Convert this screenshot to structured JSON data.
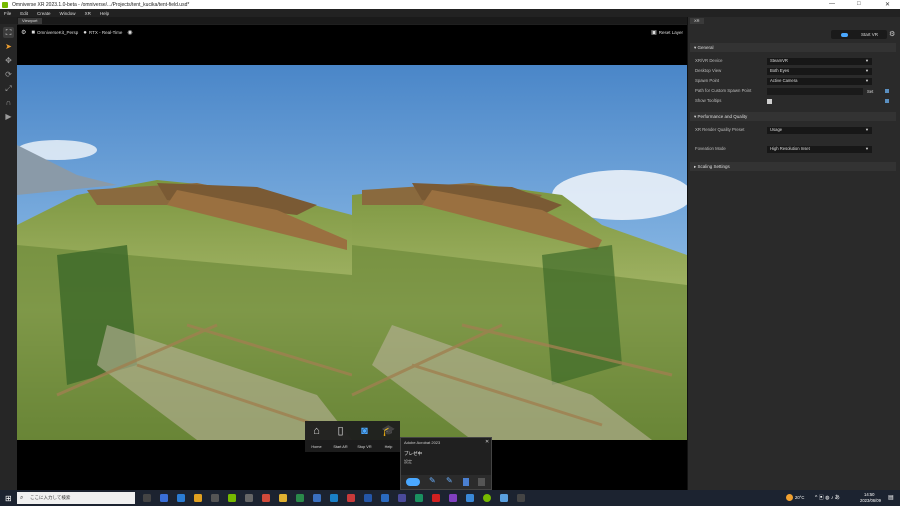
{
  "window": {
    "title": "Omniverse XR 2023.1.0-beta - /omniverse/.../Projects/tent_kucika/tent-field.usd*",
    "controls": [
      "—",
      "□",
      "✕"
    ]
  },
  "menu": [
    "File",
    "Edit",
    "Create",
    "Window",
    "XR",
    "Help"
  ],
  "viewport_tab": "Viewport",
  "viewport_toolbar": {
    "camera": "OmniverseKit_Persp",
    "renderer": "RTX - Real-Time",
    "right": "Reset Layer"
  },
  "xr_panel": {
    "tab": "XR",
    "start_button": "Start VR",
    "sections": {
      "general": "General",
      "performance": "Performance and Quality",
      "scaling": "Scaling Settings"
    },
    "rows": [
      {
        "label": "XR/VR Device",
        "value": "SteamVR"
      },
      {
        "label": "Desktop View",
        "value": "Both Eyes"
      },
      {
        "label": "Spawn Point",
        "value": "Active Camera"
      },
      {
        "label": "Path for Custom Spawn Point",
        "value": "",
        "button": "Set"
      },
      {
        "label": "Show Tooltips",
        "checked": true
      }
    ],
    "perf_rows": [
      {
        "label": "XR Render Quality Preset",
        "value": "Usage"
      },
      {
        "label": "Foveation Mode",
        "value": "High Resolution Inset"
      }
    ]
  },
  "launcher": [
    {
      "label": "Home",
      "icon": "home-icon"
    },
    {
      "label": "Start AR",
      "icon": "tablet-icon"
    },
    {
      "label": "Stop VR",
      "icon": "vr-headset-icon"
    },
    {
      "label": "Help",
      "icon": "graduation-cap-icon"
    }
  ],
  "popup": {
    "title": "Adobe Acrobat 2023",
    "body": "ブレゼ中",
    "sub": "設定"
  },
  "taskbar": {
    "search_placeholder": "ここに入力して検索",
    "weather": "20°C",
    "time": "14:50",
    "date": "2023/06/09"
  },
  "colors": {
    "accent": "#76b900",
    "vr_blue": "#4aa8ff"
  }
}
